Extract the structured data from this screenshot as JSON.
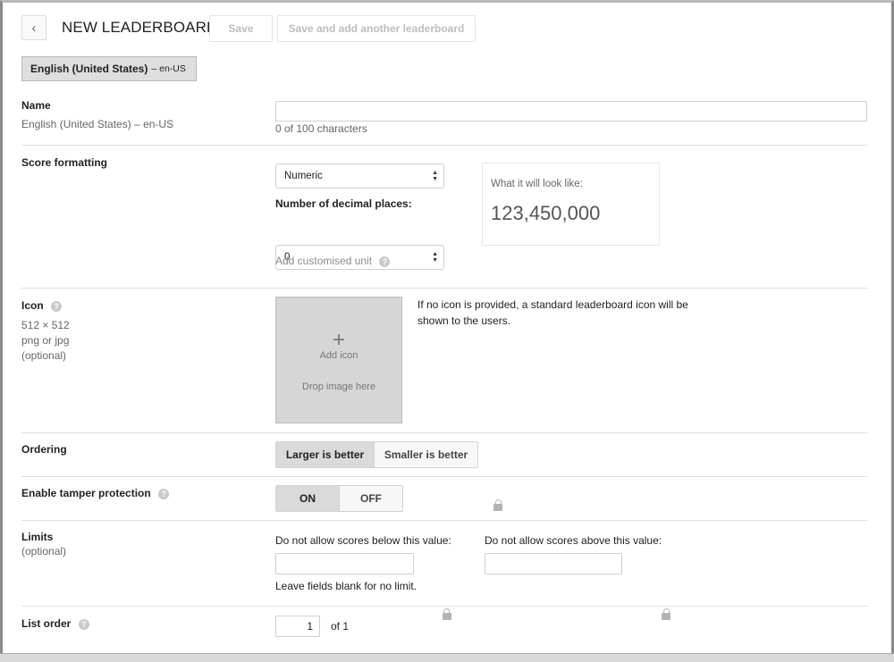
{
  "header": {
    "back_icon": "chevron-left-icon",
    "title": "NEW LEADERBOARD",
    "save_label": "Save",
    "save_another_label": "Save and add another leaderboard"
  },
  "language_tab": {
    "name": "English (United States)",
    "code": "– en-US"
  },
  "name_section": {
    "label": "Name",
    "sub": "English (United States) – en-US",
    "value": "",
    "counter": "0 of 100 characters"
  },
  "score_section": {
    "label": "Score formatting",
    "format_value": "Numeric",
    "decimal_label": "Number of decimal places:",
    "decimal_value": "0",
    "add_unit_label": "Add customised unit",
    "preview_label": "What it will look like:",
    "preview_value": "123,450,000"
  },
  "icon_section": {
    "label": "Icon",
    "size": "512 × 512",
    "format": "png or jpg",
    "optional": "(optional)",
    "add_icon": "Add icon",
    "drop_here": "Drop image here",
    "note": "If no icon is provided, a standard leaderboard icon will be shown to the users."
  },
  "ordering_section": {
    "label": "Ordering",
    "larger": "Larger is better",
    "smaller": "Smaller is better",
    "selected": "larger"
  },
  "tamper_section": {
    "label": "Enable tamper protection",
    "on": "ON",
    "off": "OFF",
    "selected": "on"
  },
  "limits_section": {
    "label": "Limits",
    "optional": "(optional)",
    "below_label": "Do not allow scores below this value:",
    "above_label": "Do not allow scores above this value:",
    "below_value": "",
    "above_value": "",
    "hint": "Leave fields blank for no limit."
  },
  "list_order_section": {
    "label": "List order",
    "value": "1",
    "of_total": "of 1"
  },
  "colors": {
    "segment_active": "#dadada",
    "segment_inactive": "#f7f7f7",
    "icon_dropzone": "#d6d6d6"
  }
}
